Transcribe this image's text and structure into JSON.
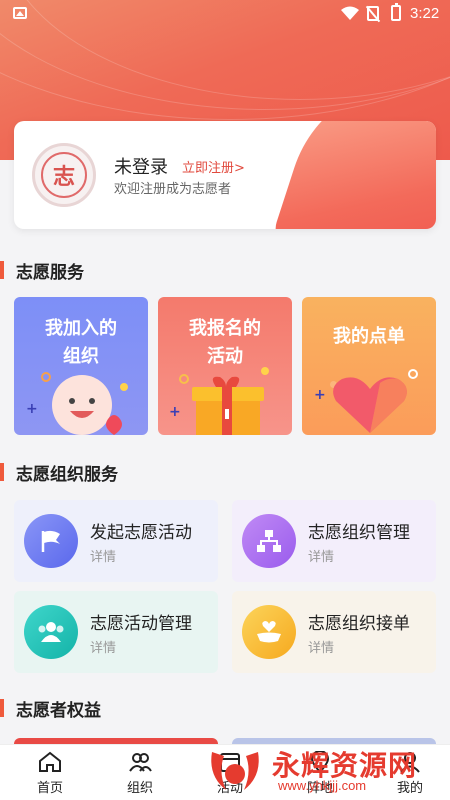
{
  "status_bar": {
    "time": "3:22"
  },
  "profile": {
    "status": "未登录",
    "register_link": "立即注册>",
    "welcome": "欢迎注册成为志愿者",
    "avatar_glyph": "志"
  },
  "sections": {
    "volunteer_service": "志愿服务",
    "org_service": "志愿组织服务",
    "benefits": "志愿者权益"
  },
  "service_tiles": [
    {
      "line1": "我加入的",
      "line2": "组织"
    },
    {
      "line1": "我报名的",
      "line2": "活动"
    },
    {
      "line1": "我的点单",
      "line2": ""
    }
  ],
  "org_cards": [
    {
      "title": "发起志愿活动",
      "sub": "详情",
      "icon": "flag-icon",
      "color": "#6f7cf0"
    },
    {
      "title": "志愿组织管理",
      "sub": "详情",
      "icon": "org-chart-icon",
      "color": "#a86cf0"
    },
    {
      "title": "志愿活动管理",
      "sub": "详情",
      "icon": "people-icon",
      "color": "#1fc3b8"
    },
    {
      "title": "志愿组织接单",
      "sub": "详情",
      "icon": "heart-hand-icon",
      "color": "#f8b52c"
    }
  ],
  "bottom_nav": [
    {
      "label": "首页",
      "icon": "home-icon"
    },
    {
      "label": "组织",
      "icon": "group-icon"
    },
    {
      "label": "活动",
      "icon": "activity-icon"
    },
    {
      "label": "阵地",
      "icon": "location-icon"
    },
    {
      "label": "我的",
      "icon": "user-icon"
    }
  ],
  "watermark": {
    "name": "永辉资源网",
    "url": "www.yhkjjj.com"
  },
  "colors": {
    "accent": "#ef5a3c",
    "header": "#ee6a56"
  }
}
